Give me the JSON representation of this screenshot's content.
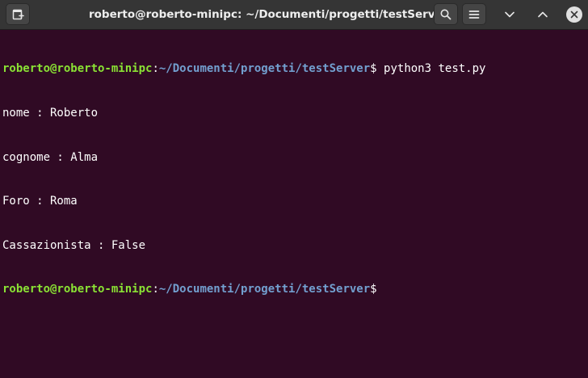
{
  "window": {
    "title": "roberto@roberto-minipc: ~/Documenti/progetti/testServer"
  },
  "headerbar": {
    "new_tab_icon": "new-tab-icon",
    "search_icon": "search-icon",
    "menu_icon": "hamburger-menu-icon",
    "minimize_icon": "chevron-down-icon",
    "maximize_icon": "chevron-up-icon",
    "close_icon": "close-icon"
  },
  "terminal": {
    "prompt1": {
      "user": "roberto@roberto-minipc",
      "sep": ":",
      "path": "~/Documenti/progetti/testServer",
      "dollar": "$",
      "command": " python3 test.py"
    },
    "output": [
      "nome : Roberto",
      "cognome : Alma",
      "Foro : Roma",
      "Cassazionista : False"
    ],
    "prompt2": {
      "user": "roberto@roberto-minipc",
      "sep": ":",
      "path": "~/Documenti/progetti/testServer",
      "dollar": "$"
    }
  },
  "colors": {
    "background": "#300a24",
    "prompt_user": "#8ae234",
    "prompt_path": "#729fcf",
    "text": "#ffffff",
    "headerbar": "#353535"
  }
}
